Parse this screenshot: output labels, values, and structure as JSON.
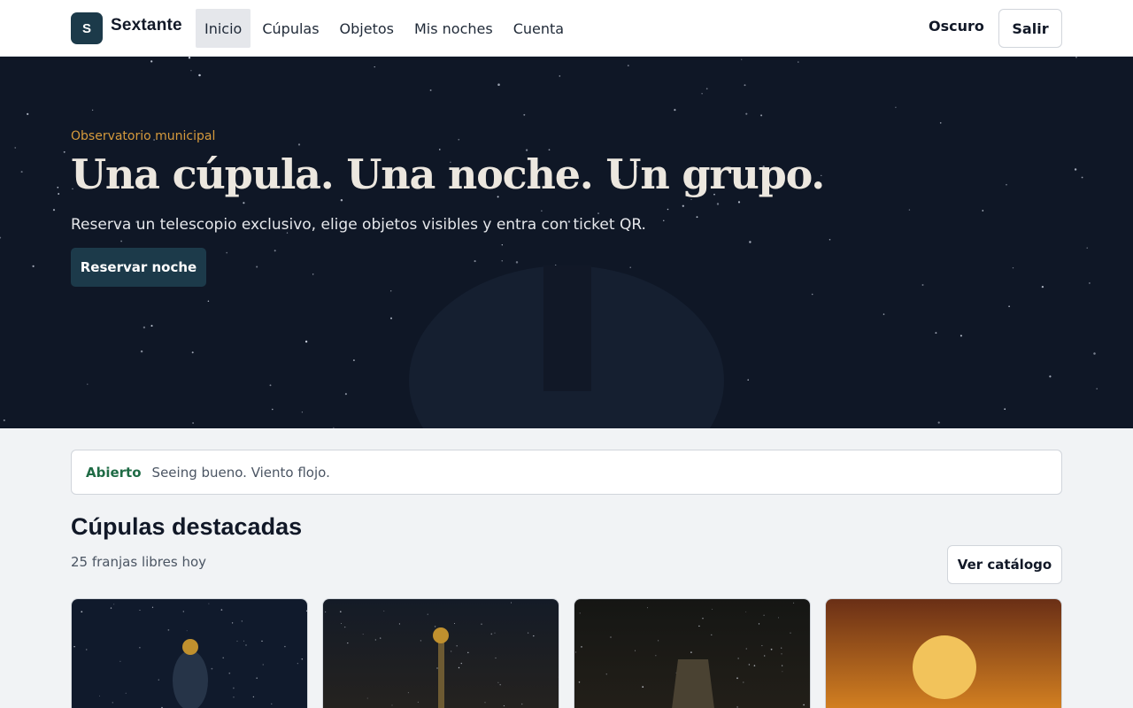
{
  "header": {
    "logo_letter": "S",
    "brand": "Sextante",
    "nav": [
      {
        "label": "Inicio",
        "active": true
      },
      {
        "label": "Cúpulas",
        "active": false
      },
      {
        "label": "Objetos",
        "active": false
      },
      {
        "label": "Mis noches",
        "active": false
      },
      {
        "label": "Cuenta",
        "active": false
      }
    ],
    "theme_toggle": "Oscuro",
    "logout": "Salir"
  },
  "hero": {
    "eyebrow": "Observatorio municipal",
    "title": "Una cúpula. Una noche. Un grupo.",
    "subtitle": "Reserva un telescopio exclusivo, elige objetos visibles y entra con ticket QR.",
    "cta": "Reservar noche"
  },
  "status": {
    "badge": "Abierto",
    "text": "Seeing bueno. Viento flojo."
  },
  "featured": {
    "title": "Cúpulas destacadas",
    "subtitle": "25 franjas libres hoy",
    "catalog_button": "Ver catálogo",
    "cards": [
      {
        "name": "dome-card-1",
        "theme": "night-blue"
      },
      {
        "name": "dome-card-2",
        "theme": "night-brown"
      },
      {
        "name": "dome-card-3",
        "theme": "night-dark"
      },
      {
        "name": "dome-card-4",
        "theme": "sunset"
      }
    ]
  },
  "colors": {
    "brand": "#1c3a4a",
    "hero_bg": "#0f1726",
    "accent": "#d69a3c",
    "status_ok": "#1f6b45",
    "page_bg": "#f1f3f5"
  }
}
